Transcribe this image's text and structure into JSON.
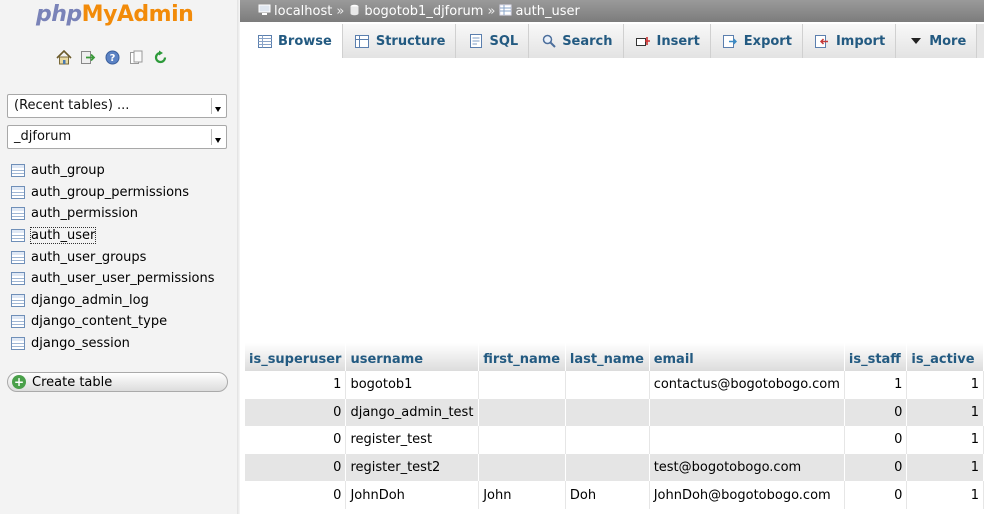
{
  "logo": {
    "part1": "php",
    "part2": "MyAdmin"
  },
  "nav": {
    "quick_icons": [
      "home-icon",
      "logout-icon",
      "help-icon",
      "docs-icon",
      "reload-icon"
    ],
    "recent_tables_value": "(Recent tables) ...",
    "database_value": "_djforum",
    "tables": [
      "auth_group",
      "auth_group_permissions",
      "auth_permission",
      "auth_user",
      "auth_user_groups",
      "auth_user_user_permissions",
      "django_admin_log",
      "django_content_type",
      "django_session"
    ],
    "current_table": "auth_user",
    "create_table_label": "Create table"
  },
  "breadcrumb": {
    "server": "localhost",
    "database": "bogotob1_djforum",
    "table": "auth_user",
    "separator": "»"
  },
  "tabs": [
    {
      "label": "Browse",
      "icon": "browse-icon",
      "active": true
    },
    {
      "label": "Structure",
      "icon": "structure-icon",
      "active": false
    },
    {
      "label": "SQL",
      "icon": "sql-icon",
      "active": false
    },
    {
      "label": "Search",
      "icon": "search-icon",
      "active": false
    },
    {
      "label": "Insert",
      "icon": "insert-icon",
      "active": false
    },
    {
      "label": "Export",
      "icon": "export-icon",
      "active": false
    },
    {
      "label": "Import",
      "icon": "import-icon",
      "active": false
    },
    {
      "label": "More",
      "icon": "chevron-down-icon",
      "active": false
    }
  ],
  "results": {
    "columns": [
      "is_superuser",
      "username",
      "first_name",
      "last_name",
      "email",
      "is_staff",
      "is_active"
    ],
    "rows": [
      [
        "1",
        "bogotob1",
        "",
        "",
        "contactus@bogotobogo.com",
        "1",
        "1"
      ],
      [
        "0",
        "django_admin_test",
        "",
        "",
        "",
        "0",
        "1"
      ],
      [
        "0",
        "register_test",
        "",
        "",
        "",
        "0",
        "1"
      ],
      [
        "0",
        "register_test2",
        "",
        "",
        "test@bogotobogo.com",
        "0",
        "1"
      ],
      [
        "0",
        "JohnDoh",
        "John",
        "Doh",
        "JohnDoh@bogotobogo.com",
        "0",
        "1"
      ]
    ]
  },
  "colors": {
    "link_blue": "#235a81",
    "logo_orange": "#f28b0a",
    "logo_php": "#7a83b8",
    "row_alt": "#e5e5e5"
  }
}
